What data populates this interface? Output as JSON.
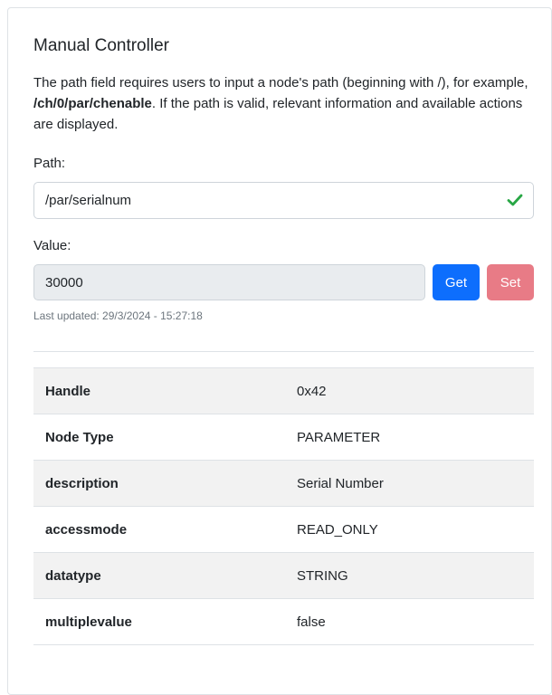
{
  "panel": {
    "title": "Manual Controller",
    "description_parts": {
      "before": "The path field requires users to input a node's path (beginning with /), for example, ",
      "example_path": "/ch/0/par/chenable",
      "after": ". If the path is valid, relevant information and available actions are displayed."
    }
  },
  "path_field": {
    "label": "Path:",
    "value": "/par/serialnum",
    "valid_icon": "check-icon",
    "valid_color": "#28a745"
  },
  "value_field": {
    "label": "Value:",
    "value": "30000",
    "get_label": "Get",
    "set_label": "Set",
    "last_updated": "Last updated: 29/3/2024 - 15:27:18"
  },
  "colors": {
    "primary": "#0d6efd",
    "danger_disabled": "#e87b86",
    "stripe": "#f2f2f2"
  },
  "info_table": [
    {
      "key": "Handle",
      "value": "0x42"
    },
    {
      "key": "Node Type",
      "value": "PARAMETER"
    },
    {
      "key": "description",
      "value": "Serial Number"
    },
    {
      "key": "accessmode",
      "value": "READ_ONLY"
    },
    {
      "key": "datatype",
      "value": "STRING"
    },
    {
      "key": "multiplevalue",
      "value": "false"
    }
  ]
}
